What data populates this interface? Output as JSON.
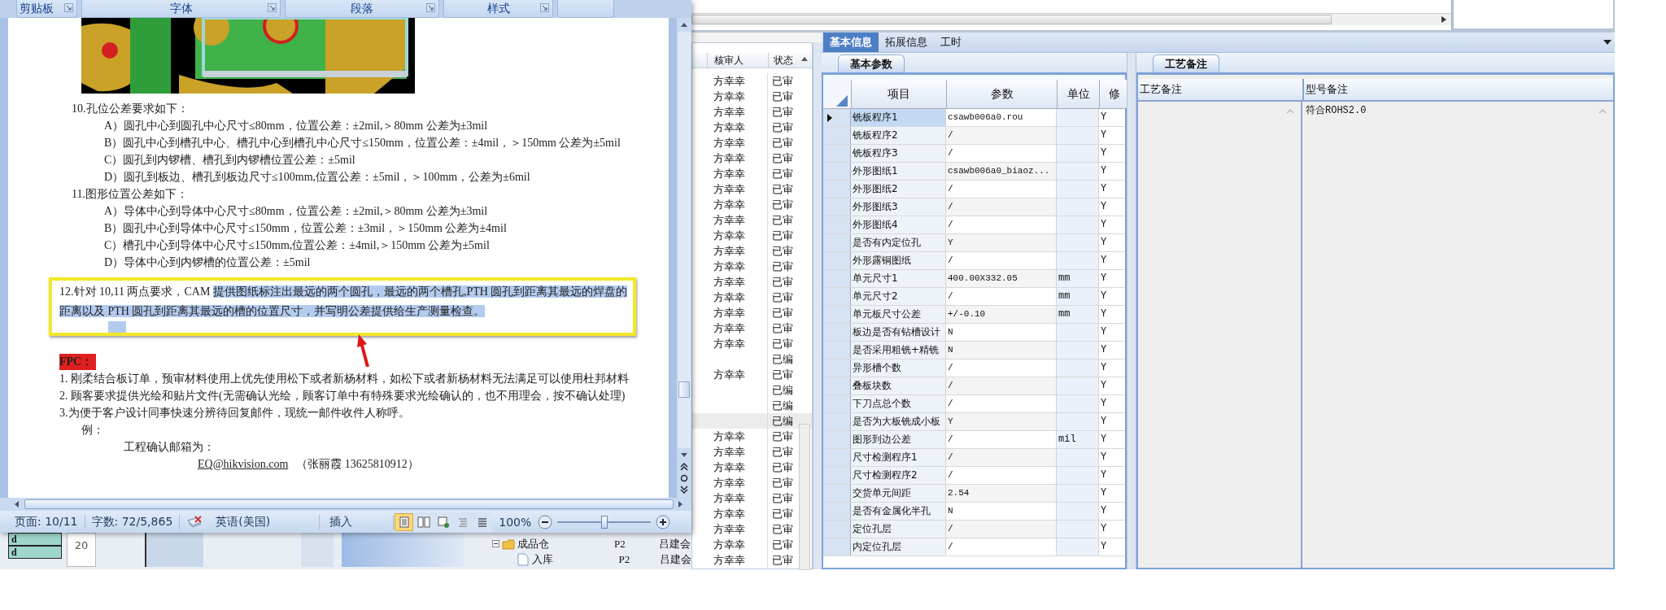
{
  "word_window": {
    "ribbon_groups": [
      {
        "label": "剪贴板"
      },
      {
        "label": "字体"
      },
      {
        "label": "段落"
      },
      {
        "label": "样式"
      }
    ],
    "document": {
      "outline": [
        {
          "text": "10.孔位公差要求如下：",
          "children": [
            {
              "text": "A）圆孔中心到圆孔中心尺寸≤80mm，位置公差：±2mil,＞80mm 公差为±3mil"
            },
            {
              "text": "B）圆孔中心到槽孔中心、槽孔中心到槽孔中心尺寸≤150mm，位置公差：±4mil，＞150mm 公差为±5mil"
            },
            {
              "text": "C）圆孔到内锣槽、槽孔到内锣槽位置公差：±5mil"
            },
            {
              "text": "D）圆孔到板边、槽孔到板边尺寸≤100mm,位置公差：±5mil，＞100mm，公差为±6mil"
            }
          ]
        },
        {
          "text": "11.图形位置公差如下：",
          "children": [
            {
              "text": "A）导体中心到导体中心尺寸≤80mm，位置公差：±2mil,＞80mm 公差为±3mil"
            },
            {
              "text": "B）圆孔中心到导体中心尺寸≤150mm，位置公差：±3mil，＞150mm 公差为±4mil"
            },
            {
              "text": "C）槽孔中心到导体中心尺寸≤150mm,位置公差：±4mil,＞150mm 公差为±5mil"
            },
            {
              "text": "D）导体中心到内锣槽的位置公差：±5mil"
            }
          ]
        }
      ],
      "highlighted_paragraph": {
        "text": "12.针对 10,11 两点要求，CAM ",
        "selected_text": "提供图纸标注出最远的两个圆孔，最远的两个槽孔,PTH 圆孔到距离其最远的焊盘的距离以及 PTH 圆孔到距离其最远的槽的位置尺寸，并写明公差提供给生产测量检查。"
      },
      "fpc_label": "FPC：",
      "paragraphs": [
        "1. 刚柔结合板订单，预审材料使用上优先使用松下或者新杨材料，如松下或者新杨材料无法满足可以使用杜邦材料",
        "2. 顾客要求提供光绘和贴片文件(无需确认光绘，顾客订单中有特殊要求光绘确认的，也不用理会，按不确认处理)",
        "3.为便于客户设计同事快速分辨待回复邮件，现统一邮件收件人称呼。"
      ],
      "example": {
        "label": "例：",
        "heading": "工程确认邮箱为：",
        "email": "EQ@hikvision.com",
        "contact": "（张丽霞 13625810912）"
      }
    },
    "status_bar": {
      "page": "页面: 10/11",
      "word_count": "字数: 72/5,865",
      "language": "英语(美国)",
      "mode": "插入",
      "view_buttons": [
        {
          "selected": true
        },
        {
          "selected": false
        },
        {
          "selected": false
        },
        {
          "selected": false
        },
        {
          "selected": false
        }
      ],
      "zoom": "100%",
      "zoom_slider": {
        "level": 0.5
      }
    }
  },
  "left_panel": {
    "cells": [
      "d",
      "d"
    ],
    "row_number": "20",
    "tree": [
      {
        "label": "成品仓",
        "kind": "folder",
        "expanded": true,
        "column_2": "P2",
        "column_3": "吕建会",
        "children": [
          {
            "label": "入库",
            "kind": "document",
            "column_2": "P2",
            "column_3": "吕建会"
          }
        ]
      }
    ]
  },
  "review_list": {
    "columns": [
      "核审人",
      "状态"
    ],
    "rows": [
      {
        "reviewer": "方幸幸",
        "status": "已审",
        "selected": false
      },
      {
        "reviewer": "方幸幸",
        "status": "已审",
        "selected": false
      },
      {
        "reviewer": "方幸幸",
        "status": "已审",
        "selected": false
      },
      {
        "reviewer": "方幸幸",
        "status": "已审",
        "selected": false
      },
      {
        "reviewer": "方幸幸",
        "status": "已审",
        "selected": false
      },
      {
        "reviewer": "方幸幸",
        "status": "已审",
        "selected": false
      },
      {
        "reviewer": "方幸幸",
        "status": "已审",
        "selected": false
      },
      {
        "reviewer": "方幸幸",
        "status": "已审",
        "selected": false
      },
      {
        "reviewer": "方幸幸",
        "status": "已审",
        "selected": false
      },
      {
        "reviewer": "方幸幸",
        "status": "已审",
        "selected": false
      },
      {
        "reviewer": "方幸幸",
        "status": "已审",
        "selected": false
      },
      {
        "reviewer": "方幸幸",
        "status": "已审",
        "selected": false
      },
      {
        "reviewer": "方幸幸",
        "status": "已审",
        "selected": false
      },
      {
        "reviewer": "方幸幸",
        "status": "已审",
        "selected": false
      },
      {
        "reviewer": "方幸幸",
        "status": "已审",
        "selected": false
      },
      {
        "reviewer": "方幸幸",
        "status": "已审",
        "selected": false
      },
      {
        "reviewer": "方幸幸",
        "status": "已审",
        "selected": false
      },
      {
        "reviewer": "方幸幸",
        "status": "已审",
        "selected": false
      },
      {
        "status": "已编",
        "selected": false
      },
      {
        "reviewer": "方幸幸",
        "status": "已审",
        "selected": false
      },
      {
        "status": "已编",
        "selected": false
      },
      {
        "status": "已编",
        "selected": false
      },
      {
        "status": "已编",
        "selected": true
      },
      {
        "reviewer": "方幸幸",
        "status": "已审",
        "selected": false
      },
      {
        "reviewer": "方幸幸",
        "status": "已审",
        "selected": false
      },
      {
        "reviewer": "方幸幸",
        "status": "已审",
        "selected": false
      },
      {
        "reviewer": "方幸幸",
        "status": "已审",
        "selected": false
      },
      {
        "reviewer": "方幸幸",
        "status": "已审",
        "selected": false
      },
      {
        "reviewer": "方幸幸",
        "status": "已审",
        "selected": false
      },
      {
        "reviewer": "方幸幸",
        "status": "已审",
        "selected": false
      },
      {
        "reviewer": "方幸幸",
        "status": "已审",
        "selected": false
      },
      {
        "reviewer": "方幸幸",
        "status": "已审",
        "selected": false
      }
    ]
  },
  "detail_panel": {
    "tabs": [
      {
        "label": "基本信息",
        "selected": true
      },
      {
        "label": "拓展信息",
        "selected": false
      },
      {
        "label": "工时",
        "selected": false
      }
    ],
    "parameters": {
      "tab": "基本参数",
      "columns": [
        "项目",
        "参数",
        "单位",
        "修"
      ],
      "rows": [
        {
          "item": "铣板程序1",
          "value": "csawb006a0.rou",
          "modified": "Y",
          "selected": true
        },
        {
          "item": "铣板程序2",
          "value": "/",
          "modified": "Y",
          "selected": false
        },
        {
          "item": "铣板程序3",
          "value": "/",
          "modified": "Y",
          "selected": false
        },
        {
          "item": "外形图纸1",
          "value": "csawb006a0_biaoz...",
          "modified": "Y",
          "selected": false
        },
        {
          "item": "外形图纸2",
          "value": "/",
          "modified": "Y",
          "selected": false
        },
        {
          "item": "外形图纸3",
          "value": "/",
          "modified": "Y",
          "selected": false
        },
        {
          "item": "外形图纸4",
          "value": "/",
          "modified": "Y",
          "selected": false
        },
        {
          "item": "是否有内定位孔",
          "value": "Y",
          "modified": "Y",
          "selected": false
        },
        {
          "item": "外形露铜图纸",
          "value": "/",
          "modified": "Y",
          "selected": false
        },
        {
          "item": "单元尺寸1",
          "value": "400.00X332.05",
          "unit": "mm",
          "modified": "Y",
          "selected": false
        },
        {
          "item": "单元尺寸2",
          "value": "/",
          "unit": "mm",
          "modified": "Y",
          "selected": false
        },
        {
          "item": "单元板尺寸公差",
          "value": "+/-0.10",
          "unit": "mm",
          "modified": "Y",
          "selected": false
        },
        {
          "item": "板边是否有钻槽设计",
          "value": "N",
          "modified": "Y",
          "selected": false
        },
        {
          "item": "是否采用粗铣+精铣",
          "value": "N",
          "modified": "Y",
          "selected": false
        },
        {
          "item": "异形槽个数",
          "value": "/",
          "modified": "Y",
          "selected": false
        },
        {
          "item": "叠板块数",
          "value": "/",
          "modified": "Y",
          "selected": false
        },
        {
          "item": "下刀点总个数",
          "value": "/",
          "modified": "Y",
          "selected": false
        },
        {
          "item": "是否为大板铣成小板",
          "value": "Y",
          "modified": "Y",
          "selected": false
        },
        {
          "item": "图形到边公差",
          "value": "/",
          "unit": "mil",
          "modified": "Y",
          "selected": false
        },
        {
          "item": "尺寸检测程序1",
          "value": "/",
          "modified": "Y",
          "selected": false
        },
        {
          "item": "尺寸检测程序2",
          "value": "/",
          "modified": "Y",
          "selected": false
        },
        {
          "item": "交货单元间距",
          "value": "2.54",
          "modified": "Y",
          "selected": false
        },
        {
          "item": "是否有金属化半孔",
          "value": "N",
          "modified": "Y",
          "selected": false
        },
        {
          "item": "定位孔层",
          "value": "/",
          "modified": "Y",
          "selected": false
        },
        {
          "item": "内定位孔层",
          "value": "/",
          "modified": "Y",
          "selected": false
        }
      ]
    },
    "notes": {
      "tab": "工艺备注",
      "columns": [
        "工艺备注",
        "型号备注"
      ],
      "model_note": "符合ROHS2.0"
    }
  }
}
